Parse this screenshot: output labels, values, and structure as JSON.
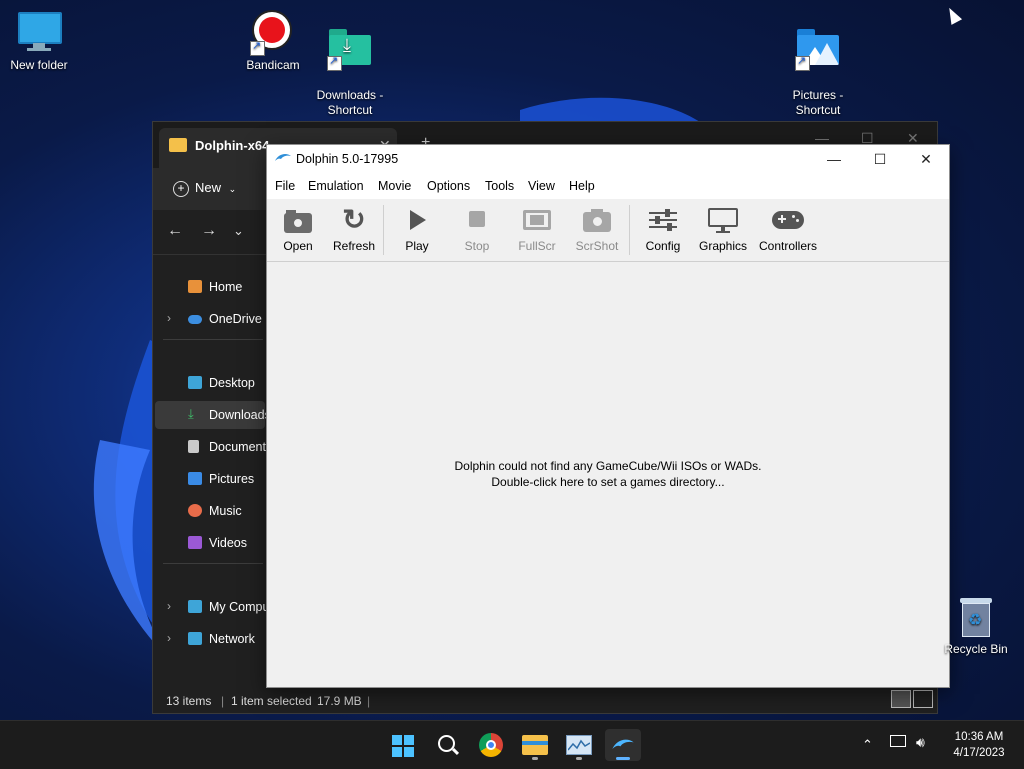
{
  "desktop": {
    "icons": [
      {
        "label": "New folder",
        "icon": "monitor-icon"
      },
      {
        "label": "Bandicam",
        "icon": "record-icon"
      },
      {
        "label": "Downloads -\nShortcut",
        "icon": "downloads-folder-icon"
      },
      {
        "label": "Pictures -\nShortcut",
        "icon": "pictures-folder-icon"
      },
      {
        "label": "Recycle Bin",
        "icon": "recycle-bin-icon"
      }
    ]
  },
  "explorer": {
    "tab_title": "Dolphin-x64",
    "new_label": "New",
    "sidebar": [
      {
        "label": "Home",
        "icon": "home-icon",
        "color": "#e8913a"
      },
      {
        "label": "OneDrive",
        "icon": "cloud-icon",
        "color": "#3c8ee0"
      },
      {
        "label": "Desktop",
        "icon": "desktop-icon",
        "color": "#3ea5d8"
      },
      {
        "label": "Downloads",
        "icon": "download-icon",
        "color": "#3fbf6a"
      },
      {
        "label": "Documents",
        "icon": "document-icon",
        "color": "#c9c9c9"
      },
      {
        "label": "Pictures",
        "icon": "pictures-icon",
        "color": "#3a8be6"
      },
      {
        "label": "Music",
        "icon": "music-icon",
        "color": "#e86c4a"
      },
      {
        "label": "Videos",
        "icon": "videos-icon",
        "color": "#9b59d6"
      },
      {
        "label": "My Computer",
        "icon": "computer-icon",
        "color": "#3ea5d8"
      },
      {
        "label": "Network",
        "icon": "network-icon",
        "color": "#3ea5d8"
      }
    ],
    "status": {
      "items": "13 items",
      "selected": "1 item selected",
      "size": "17.9 MB"
    }
  },
  "dolphin": {
    "title": "Dolphin 5.0-17995",
    "menu": [
      "File",
      "Emulation",
      "Movie",
      "Options",
      "Tools",
      "View",
      "Help"
    ],
    "toolbar": [
      {
        "label": "Open",
        "icon": "open-disc-icon",
        "enabled": true
      },
      {
        "label": "Refresh",
        "icon": "refresh-icon",
        "enabled": true
      },
      {
        "label": "Play",
        "icon": "play-icon",
        "enabled": true
      },
      {
        "label": "Stop",
        "icon": "stop-icon",
        "enabled": false
      },
      {
        "label": "FullScr",
        "icon": "fullscreen-icon",
        "enabled": false
      },
      {
        "label": "ScrShot",
        "icon": "camera-icon",
        "enabled": false
      },
      {
        "label": "Config",
        "icon": "sliders-icon",
        "enabled": true
      },
      {
        "label": "Graphics",
        "icon": "monitor-icon",
        "enabled": true
      },
      {
        "label": "Controllers",
        "icon": "gamepad-icon",
        "enabled": true
      }
    ],
    "empty_line1": "Dolphin could not find any GameCube/Wii ISOs or WADs.",
    "empty_line2": "Double-click here to set a games directory..."
  },
  "taskbar": {
    "time": "10:36 AM",
    "date": "4/17/2023"
  }
}
